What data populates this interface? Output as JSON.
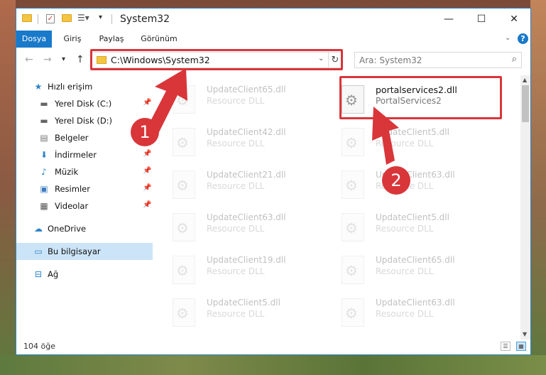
{
  "window": {
    "title": "System32",
    "minimize": "—",
    "maximize": "☐",
    "close": "✕"
  },
  "ribbon": {
    "tabs": [
      "Dosya",
      "Giriş",
      "Paylaş",
      "Görünüm"
    ],
    "active_tab": "Dosya",
    "help": "?"
  },
  "address": {
    "path": "C:\\Windows\\System32",
    "search_placeholder": "Ara: System32"
  },
  "nav": {
    "quick_access": "Hızlı erişim",
    "items": [
      {
        "label": "Yerel Disk (C:)",
        "icon": "drive-icon",
        "pinned": true
      },
      {
        "label": "Yerel Disk (D:)",
        "icon": "drive-icon",
        "pinned": false
      },
      {
        "label": "Belgeler",
        "icon": "documents-icon",
        "pinned": true
      },
      {
        "label": "İndirmeler",
        "icon": "downloads-icon",
        "pinned": true
      },
      {
        "label": "Müzik",
        "icon": "music-icon",
        "pinned": true
      },
      {
        "label": "Resimler",
        "icon": "pictures-icon",
        "pinned": true
      },
      {
        "label": "Videolar",
        "icon": "videos-icon",
        "pinned": true
      }
    ],
    "onedrive": "OneDrive",
    "this_pc": "Bu bilgisayar",
    "network": "Ağ"
  },
  "files": {
    "left": [
      {
        "name": "UpdateClient65.dll",
        "desc": "Resource DLL"
      },
      {
        "name": "UpdateClient42.dll",
        "desc": "Resource DLL"
      },
      {
        "name": "UpdateClient21.dll",
        "desc": "Resource DLL"
      },
      {
        "name": "UpdateClient63.dll",
        "desc": "Resource DLL"
      },
      {
        "name": "UpdateClient19.dll",
        "desc": "Resource DLL"
      },
      {
        "name": "UpdateClient5.dll",
        "desc": "Resource DLL"
      }
    ],
    "right": [
      {
        "name": "portalservices2.dll",
        "desc": "PortalServices2"
      },
      {
        "name": "UpdateClient5.dll",
        "desc": "Resource DLL"
      },
      {
        "name": "UpdateClient63.dll",
        "desc": "Resource DLL"
      },
      {
        "name": "UpdateClient5.dll",
        "desc": "Resource DLL"
      },
      {
        "name": "UpdateClient65.dll",
        "desc": "Resource DLL"
      },
      {
        "name": "UpdateClient63.dll",
        "desc": "Resource DLL"
      }
    ]
  },
  "status": {
    "item_count": "104 öğe"
  },
  "annotations": {
    "step1": "1",
    "step2": "2",
    "color": "#d9363a"
  }
}
